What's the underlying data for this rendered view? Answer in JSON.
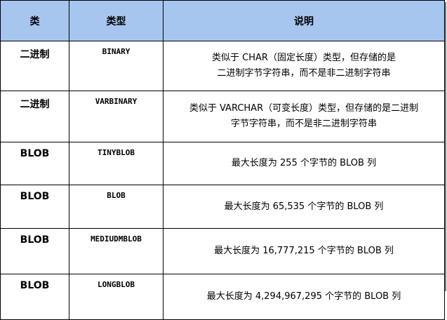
{
  "header": {
    "col_type": "类",
    "col_name": "类型",
    "col_desc": "说明"
  },
  "rows": [
    {
      "type": "二进制",
      "name": "BINARY",
      "desc": [
        "类似于 CHAR（固定长度）类型，但存储的是",
        "二进制字节字符串，而不是非二进制字符串"
      ]
    },
    {
      "type": "二进制",
      "name": "VARBINARY",
      "desc": [
        "类似于 VARCHAR（可变长度）类型，但存储的是二进制",
        "字节字符串，而不是非二进制字符串"
      ]
    },
    {
      "type": "BLOB",
      "name": "TINYBLOB",
      "desc": [
        "最大长度为 255 个字节的 BLOB 列"
      ]
    },
    {
      "type": "BLOB",
      "name": "BLOB",
      "desc": [
        "最大长度为 65,535 个字节的 BLOB 列"
      ]
    },
    {
      "type": "BLOB",
      "name": "MEDIUDMBLOB",
      "desc": [
        "最大长度为 16,777,215 个字节的 BLOB 列"
      ]
    },
    {
      "type": "BLOB",
      "name": "LONGBLOB",
      "desc": [
        "最大长度为 4,294,967,295 个字节的 BLOB 列"
      ]
    }
  ]
}
